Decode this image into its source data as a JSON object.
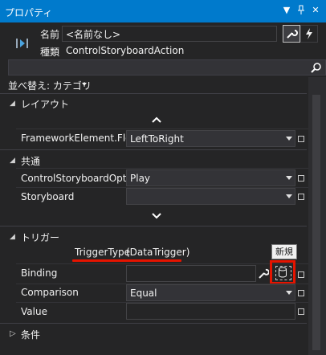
{
  "window": {
    "title": "プロパティ"
  },
  "header": {
    "name_label": "名前",
    "name_value": "<名前なし>",
    "type_label": "種類",
    "type_value": "ControlStoryboardAction"
  },
  "sort": {
    "label": "並べ替え: カテゴリ"
  },
  "sections": {
    "layout": "レイアウト",
    "common": "共通",
    "trigger": "トリガー",
    "conditions": "条件"
  },
  "layout_props": {
    "flow_label": "FrameworkElement.Flo...",
    "flow_value": "LeftToRight"
  },
  "common_props": {
    "control_label": "ControlStoryboardOpt...",
    "control_value": "Play",
    "storyboard_label": "Storyboard",
    "storyboard_value": ""
  },
  "trigger": {
    "type_label": "TriggerType",
    "type_value": "(DataTrigger)",
    "binding_label": "Binding",
    "comparison_label": "Comparison",
    "comparison_value": "Equal",
    "value_label": "Value",
    "new_tooltip": "新規"
  },
  "colors": {
    "accent": "#007acc",
    "background": "#252526",
    "highlight": "#e51400"
  }
}
